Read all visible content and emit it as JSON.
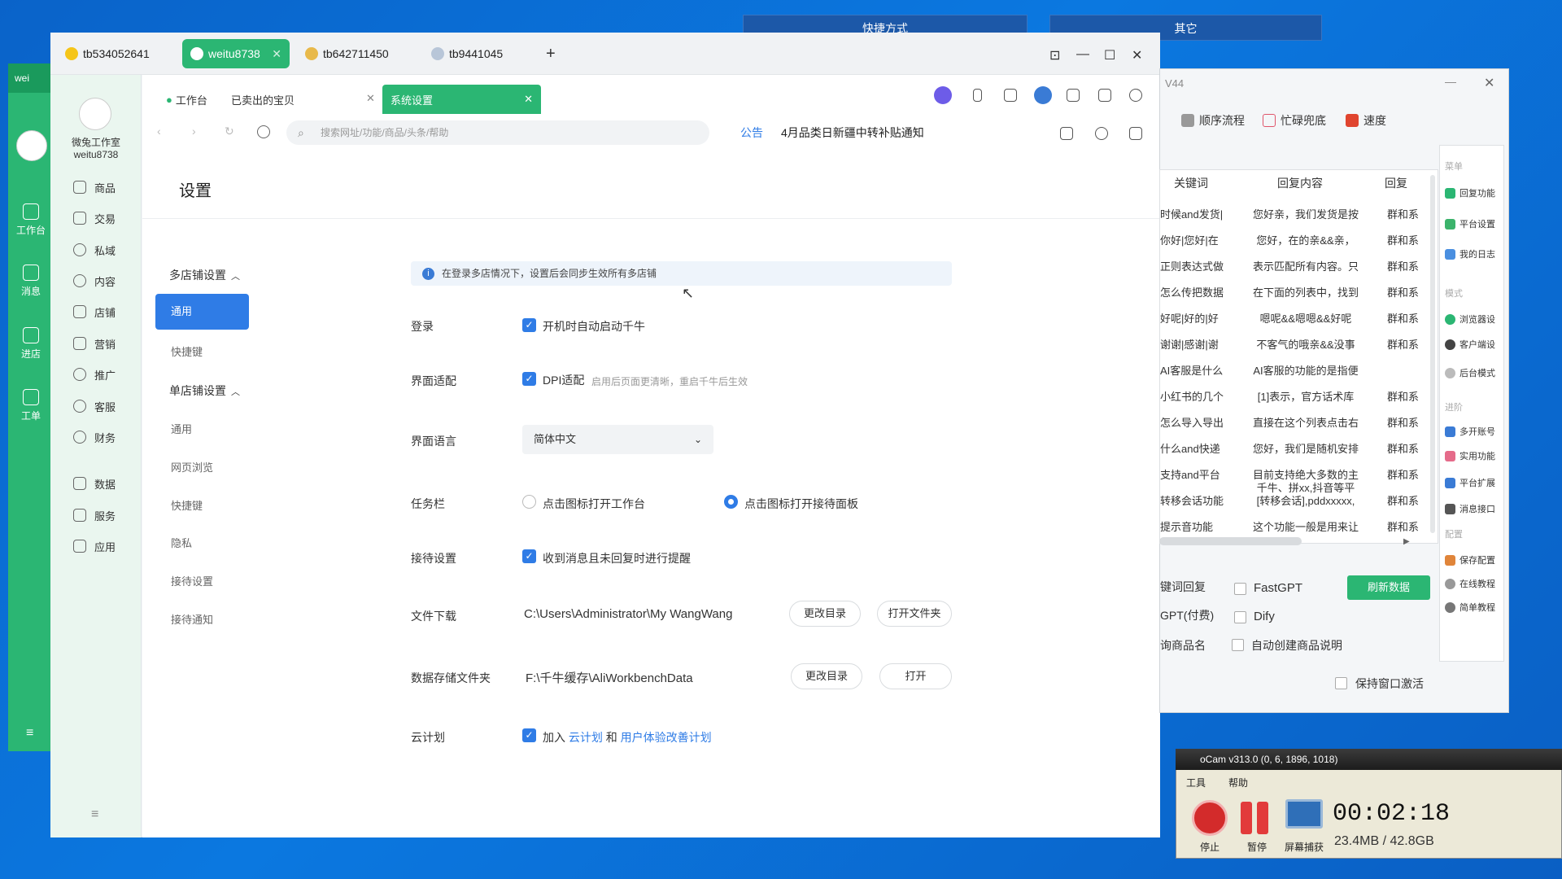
{
  "desktop": {
    "shortcuts_label": "快捷方式",
    "other_label": "其它"
  },
  "left_window": {
    "title": "wei",
    "nav": [
      "工作台",
      "消息",
      "进店",
      "工单"
    ]
  },
  "browser_tabs": [
    {
      "label": "tb534052641"
    },
    {
      "label": "weitu8738"
    },
    {
      "label": "tb642711450"
    },
    {
      "label": "tb9441045"
    }
  ],
  "shop": {
    "name_line1": "微兔工作室",
    "name_line2": "weitu8738"
  },
  "left_nav": [
    "商品",
    "交易",
    "私域",
    "内容",
    "店铺",
    "营销",
    "推广",
    "客服",
    "财务",
    "数据",
    "服务",
    "应用"
  ],
  "page_tabs": {
    "workbench": "工作台",
    "sold": "已卖出的宝贝",
    "settings": "系统设置"
  },
  "address_bar": {
    "placeholder": "搜索网址/功能/商品/头条/帮助"
  },
  "notice": {
    "label": "公告",
    "text": "4月品类日新疆中转补贴通知"
  },
  "settings": {
    "title": "设置",
    "multi_shop": "多店铺设置",
    "multi_items": [
      "通用",
      "快捷键"
    ],
    "single_shop": "单店铺设置",
    "single_items": [
      "通用",
      "网页浏览",
      "快捷键",
      "隐私",
      "接待设置",
      "接待通知"
    ],
    "info": "在登录多店情况下，设置后会同步生效所有多店铺",
    "login_label": "登录",
    "login_option": "开机时自动启动千牛",
    "dpi_label": "界面适配",
    "dpi_option": "DPI适配",
    "dpi_hint": "启用后页面更清晰，重启千牛后生效",
    "lang_label": "界面语言",
    "lang_value": "简体中文",
    "taskbar_label": "任务栏",
    "taskbar_opt1": "点击图标打开工作台",
    "taskbar_opt2": "点击图标打开接待面板",
    "reception_label": "接待设置",
    "reception_option": "收到消息且未回复时进行提醒",
    "download_label": "文件下载",
    "download_path": "C:\\Users\\Administrator\\My WangWang",
    "change_dir": "更改目录",
    "open_folder": "打开文件夹",
    "storage_label": "数据存储文件夹",
    "storage_path": "F:\\千牛缓存\\AliWorkbenchData",
    "open": "打开",
    "cloud_label": "云计划",
    "cloud_join": "加入",
    "cloud_link1": "云计划",
    "cloud_and": "和",
    "cloud_link2": "用户体验改善计划"
  },
  "right_app": {
    "title": "V44",
    "tools": [
      "顺序流程",
      "忙碌兜底",
      "速度"
    ],
    "headers": [
      "关键词",
      "回复内容",
      "回复"
    ],
    "rows": [
      [
        "时候and发货|",
        "您好亲，我们发货是按",
        "群和系"
      ],
      [
        "你好|您好|在",
        "您好，在的亲&&亲，",
        "群和系"
      ],
      [
        "正则表达式做",
        "表示匹配所有内容。只",
        "群和系"
      ],
      [
        "怎么传把数据",
        "在下面的列表中，找到",
        "群和系"
      ],
      [
        "好呢|好的|好",
        "嗯呢&&嗯嗯&&好呢",
        "群和系"
      ],
      [
        "谢谢|感谢|谢",
        "不客气的哦亲&&没事",
        "群和系"
      ],
      [
        "AI客服是什么",
        "AI客服的功能的是指便",
        ""
      ],
      [
        "小红书的几个",
        "[1]表示，官方话术库",
        "群和系"
      ],
      [
        "怎么导入导出",
        "直接在这个列表点击右",
        "群和系"
      ],
      [
        "什么and快递",
        "您好，我们是随机安排",
        "群和系"
      ],
      [
        "支持and平台",
        "目前支持绝大多数的主",
        "群和系"
      ],
      [
        "转移会话功能",
        "[转移会话],pddxxxxx,",
        "群和系"
      ],
      [
        "提示音功能",
        "这个功能一般是用来让",
        "群和系"
      ]
    ],
    "row11_extra": "千牛、拼xx,抖音等平",
    "side_menu_head": "菜单",
    "side_menu": [
      "回复功能",
      "平台设置",
      "我的日志"
    ],
    "side_mode_head": "模式",
    "side_mode": [
      "浏览器设",
      "客户端设",
      "后台模式"
    ],
    "side_adv_head": "进阶",
    "side_adv": [
      "多开账号",
      "实用功能",
      "平台扩展",
      "消息接口"
    ],
    "side_cfg_head": "配置",
    "side_cfg": [
      "保存配置",
      "在线教程",
      "简单教程"
    ],
    "bottom": {
      "kw_reply": "键词回复",
      "gpt": "GPT(付费)",
      "prod": "询商品名",
      "fastgpt": "FastGPT",
      "dify": "Dify",
      "auto_desc": "自动创建商品说明",
      "refresh": "刷新数据",
      "keep_active": "保持窗口激活"
    }
  },
  "ocam": {
    "title": "oCam v313.0 (0, 6, 1896, 1018)",
    "menu": [
      "工具",
      "帮助"
    ],
    "stop": "停止",
    "pause": "暂停",
    "capture": "屏幕捕获",
    "time": "00:02:18",
    "size": "23.4MB / 42.8GB"
  },
  "colors": {
    "accent_green": "#2bb673",
    "accent_blue": "#2f7ce6",
    "desktop": "#0a6fd6"
  }
}
